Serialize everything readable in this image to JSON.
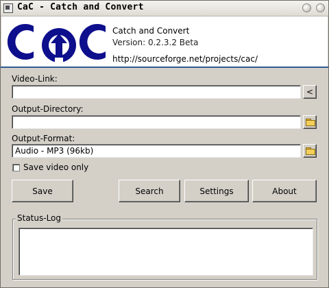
{
  "window": {
    "title": "CaC - Catch and Convert",
    "controls": [
      "minimize-icon",
      "maximize-icon",
      "close-icon"
    ]
  },
  "banner": {
    "logo_text": "CaC",
    "app_name": "Catch and Convert",
    "version": "Version: 0.2.3.2 Beta",
    "url": "http://sourceforge.net/projects/cac/"
  },
  "form": {
    "video_link_label": "Video-Link:",
    "video_link_value": "",
    "paste_button_label": "<",
    "output_directory_label": "Output-Directory:",
    "output_directory_value": "",
    "output_format_label": "Output-Format:",
    "output_format_value": "Audio - MP3 (96kb)",
    "save_video_label": "Save video only",
    "save_video_checked": false
  },
  "buttons": {
    "save": "Save",
    "search": "Search",
    "settings": "Settings",
    "about": "About"
  },
  "status": {
    "group_label": "Status-Log",
    "log": ""
  },
  "colors": {
    "logo_blue": "#0d0f8c",
    "banner_border": "#2d5a95",
    "window_bg": "#d4d0c8"
  }
}
